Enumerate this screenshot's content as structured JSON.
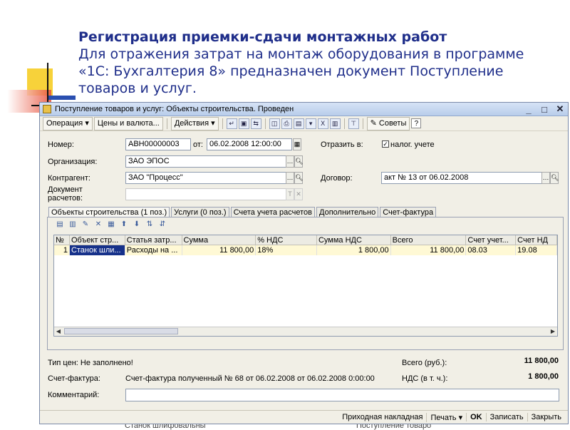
{
  "slide": {
    "title_bold": "Регистрация приемки-сдачи монтажных работ",
    "title_lines": [
      "Для отражения затрат на монтаж оборудования в программе",
      "«1С: Бухгалтерия 8» предназначен документ Поступление",
      "товаров и услуг."
    ],
    "bottom_left_text": "Станок шлифовальны",
    "bottom_right_text": "Поступление товаро"
  },
  "colors": {
    "title": "#1f2e8a",
    "deco_yellow": "#f7d23a",
    "deco_red": "#e8503a",
    "deco_blue": "#2a4fb0",
    "selection": "#16318a",
    "row_highlight": "#fff9d5"
  },
  "window": {
    "title": "Поступление товаров и услуг: Объекты строительства. Проведен",
    "controls": {
      "minimize": "_",
      "maximize": "□",
      "close": "✕"
    }
  },
  "toolbar": {
    "operation": "Операция",
    "prices": "Цены и валюта...",
    "actions": "Действия",
    "tips": "Советы",
    "help": "?",
    "icons": [
      "back-icon",
      "form-icon",
      "refresh-icon",
      "print-preview-icon",
      "print-icon",
      "post-icon",
      "unpost-icon",
      "report-icon",
      "structure-icon"
    ]
  },
  "form": {
    "number_label": "Номер:",
    "number_value": "АВН00000003",
    "date_label": "от:",
    "date_value": "06.02.2008 12:00:00",
    "reflect_label": "Отразить в:",
    "tax_checkbox_label": "налог. учете",
    "tax_checked": true,
    "org_label": "Организация:",
    "org_value": "ЗАО ЭПОС",
    "counterparty_label": "Контрагент:",
    "counterparty_value": "ЗАО \"Процесс\"",
    "contract_label": "Договор:",
    "contract_value": "акт № 13 от 06.02.2008",
    "settlement_doc_label_1": "Документ",
    "settlement_doc_label_2": "расчетов:",
    "settlement_doc_value": ""
  },
  "tabs": [
    "Объекты строительства (1 поз.)",
    "Услуги (0 поз.)",
    "Счета учета расчетов",
    "Дополнительно",
    "Счет-фактура"
  ],
  "grid": {
    "columns": [
      "№",
      "Объект стр...",
      "Статья затр...",
      "Сумма",
      "% НДС",
      "Сумма НДС",
      "Всего",
      "Счет учет...",
      "Счет НД"
    ],
    "rows": [
      [
        "1",
        "Станок шли...",
        "Расходы на ...",
        "11 800,00",
        "18%",
        "1 800,00",
        "11 800,00",
        "08.03",
        "19.08"
      ]
    ]
  },
  "summary": {
    "price_type_label": "Тип цен: Не заполнено!",
    "total_label": "Всего (руб.):",
    "total_value": "11 800,00",
    "invoice_label": "Счет-фактура:",
    "invoice_value": "Счет-фактура полученный № 68 от 06.02.2008 от 06.02.2008 0:00:00",
    "vat_label": "НДС (в т. ч.):",
    "vat_value": "1 800,00",
    "comment_label": "Комментарий:",
    "comment_value": "",
    "right_edge_total": "11 800,00",
    "right_edge_vat": "1 800,00"
  },
  "bottombar": {
    "receipt_note": "Приходная накладная",
    "print": "Печать",
    "ok": "OK",
    "save": "Записать",
    "close": "Закрыть"
  }
}
